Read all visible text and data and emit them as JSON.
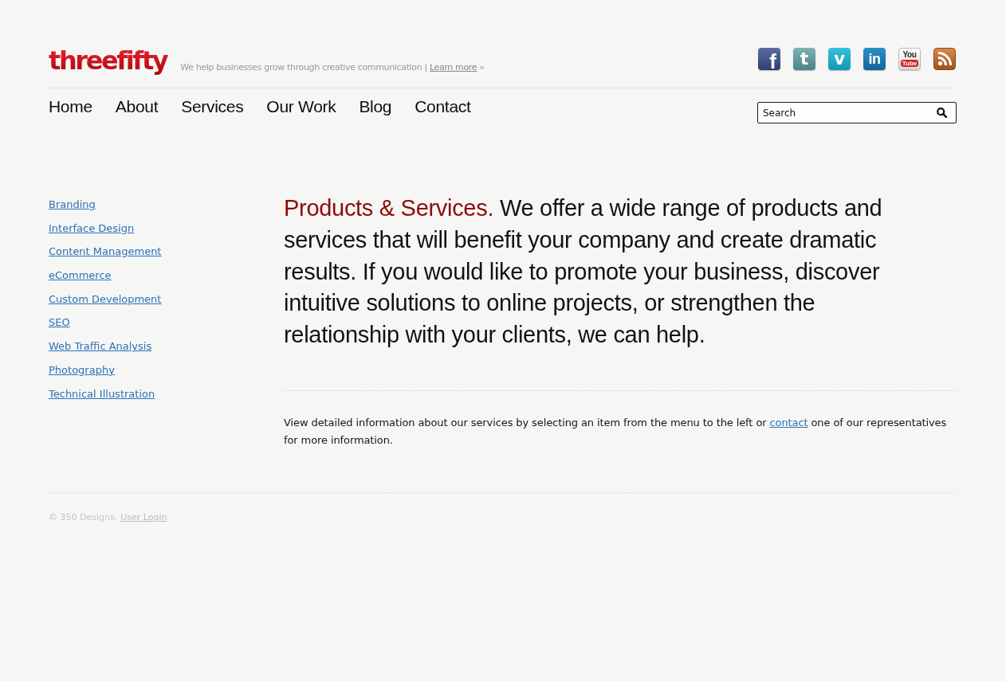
{
  "header": {
    "logo": "threefifty",
    "tagline": {
      "text": "We help businesses grow through creative communication |",
      "link": "Learn more",
      "suffix": "»"
    },
    "social": [
      {
        "kind": "facebook",
        "glyph": "f"
      },
      {
        "kind": "twitter",
        "glyph": "t"
      },
      {
        "kind": "vimeo",
        "glyph": "v"
      },
      {
        "kind": "linkedin",
        "glyph": "in"
      },
      {
        "kind": "youtube",
        "glyph": "You",
        "sub_glyph": "Tube"
      },
      {
        "kind": "rss"
      }
    ]
  },
  "nav": {
    "items": [
      "Home",
      "About",
      "Services",
      "Our Work",
      "Blog",
      "Contact"
    ]
  },
  "search": {
    "placeholder": "Search"
  },
  "sidebar": {
    "items": [
      "Branding",
      "Interface Design",
      "Content Management",
      "eCommerce",
      "Custom Development",
      "SEO",
      "Web Traffic Analysis",
      "Photography",
      "Technical Illustration"
    ]
  },
  "main": {
    "intro": {
      "lead": "Products & Services.",
      "text": "We offer a wide range of products and services that will benefit your company and create dramatic results. If you would like to promote your business, discover intuitive solutions to online projects, or strengthen the relationship with your clients, we can help."
    },
    "body": {
      "before": "View detailed information about our services by selecting an item from the menu to the left or",
      "link": "contact",
      "after": "one of our representatives for more information."
    }
  },
  "footer": {
    "copyright": "© 350 Designs.",
    "link": "User Login"
  }
}
